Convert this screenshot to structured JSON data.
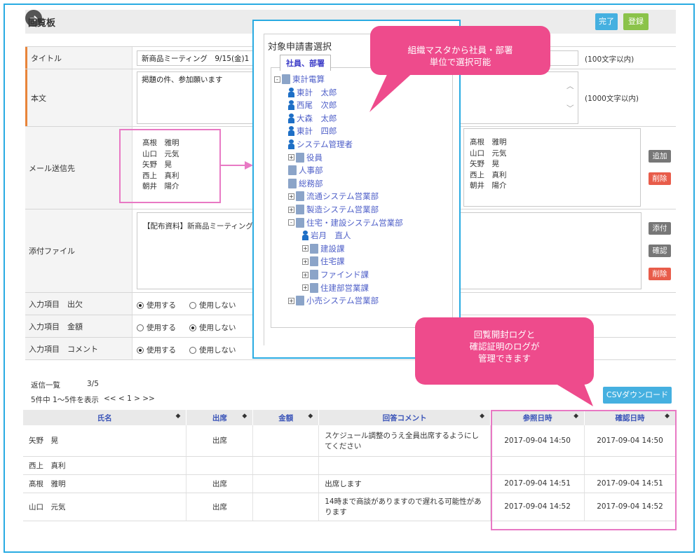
{
  "header": {
    "title": "回覧板",
    "done_label": "完了",
    "register_label": "登録",
    "back_icon": "➜"
  },
  "form": {
    "title_label": "タイトル",
    "title_value": "新商品ミーティング　9/15(金)1",
    "title_note": "(100文字以内)",
    "body_label": "本文",
    "body_value": "掲題の件、参加願います",
    "body_note": "(1000文字以内)",
    "mail_label": "メール送信先",
    "mail_recipients": [
      "髙根　雅明",
      "山口　元気",
      "矢野　晃",
      "西上　真利",
      "朝井　陽介"
    ],
    "mail_right": [
      "髙根　雅明",
      "山口　元気",
      "矢野　晃",
      "西上　真利",
      "朝井　陽介"
    ],
    "add_label": "追加",
    "delete_label": "削除",
    "attach_label": "添付ファイル",
    "attach_value": "【配布資料】新商品ミーティング",
    "attach_btn": "添付",
    "confirm_btn": "確認",
    "attach_delete": "削除",
    "attendance_label": "入力項目　出欠",
    "amount_label": "入力項目　金額",
    "comment_label": "入力項目　コメント",
    "use_label": "使用する",
    "nouse_label": "使用しない"
  },
  "dialog": {
    "title": "対象申請書選択",
    "tab_label": "社員、部署",
    "tree": [
      {
        "t": "東計電算",
        "kind": "org",
        "exp": "-",
        "lvl": 0
      },
      {
        "t": "東計　太郎",
        "kind": "person",
        "lvl": 1
      },
      {
        "t": "西尾　次郎",
        "kind": "person",
        "lvl": 1
      },
      {
        "t": "大森　太郎",
        "kind": "person",
        "lvl": 1
      },
      {
        "t": "東計　四郎",
        "kind": "person",
        "lvl": 1
      },
      {
        "t": "システム管理者",
        "kind": "person",
        "lvl": 1
      },
      {
        "t": "役員",
        "kind": "org",
        "exp": "+",
        "lvl": 1
      },
      {
        "t": "人事部",
        "kind": "org",
        "lvl": 1
      },
      {
        "t": "総務部",
        "kind": "org",
        "lvl": 1
      },
      {
        "t": "流通システム営業部",
        "kind": "org",
        "exp": "+",
        "lvl": 1
      },
      {
        "t": "製造システム営業部",
        "kind": "org",
        "exp": "+",
        "lvl": 1
      },
      {
        "t": "住宅・建設システム営業部",
        "kind": "org",
        "exp": "-",
        "lvl": 1
      },
      {
        "t": "岩月　直人",
        "kind": "person",
        "lvl": 2
      },
      {
        "t": "建設課",
        "kind": "org",
        "exp": "+",
        "lvl": 2
      },
      {
        "t": "住宅課",
        "kind": "org",
        "exp": "+",
        "lvl": 2
      },
      {
        "t": "ファインド課",
        "kind": "org",
        "exp": "+",
        "lvl": 2
      },
      {
        "t": "住建部営業課",
        "kind": "org",
        "exp": "+",
        "lvl": 2
      },
      {
        "t": "小売システム営業部",
        "kind": "org",
        "exp": "+",
        "lvl": 1
      }
    ]
  },
  "callouts": {
    "top": [
      "組織マスタから社員・部署",
      "単位で選択可能"
    ],
    "bottom": [
      "回覧開封ログと",
      "確認証明のログが",
      "管理できます"
    ]
  },
  "replies": {
    "heading": "返信一覧",
    "count": "3/5",
    "paging": "5件中 1～5件を表示",
    "pager": "<< < 1 > >>",
    "csv_label": "CSVダウンロード",
    "columns": [
      "氏名",
      "出席",
      "金額",
      "回答コメント",
      "参照日時",
      "確認日時"
    ],
    "rows": [
      {
        "name": "矢野　晃",
        "att": "出席",
        "amt": "",
        "comment": "スケジュール調整のうえ全員出席するようにしてください",
        "ref": "2017-09-04 14:50",
        "conf": "2017-09-04 14:50"
      },
      {
        "name": "西上　真利",
        "att": "",
        "amt": "",
        "comment": "",
        "ref": "",
        "conf": ""
      },
      {
        "name": "髙根　雅明",
        "att": "出席",
        "amt": "",
        "comment": "出席します",
        "ref": "2017-09-04 14:51",
        "conf": "2017-09-04 14:51"
      },
      {
        "name": "山口　元気",
        "att": "出席",
        "amt": "",
        "comment": "14時まで商談がありますので遅れる可能性があります",
        "ref": "2017-09-04 14:52",
        "conf": "2017-09-04 14:52"
      }
    ]
  },
  "colors": {
    "accent": "#29abe2",
    "callout": "#ee4b8c",
    "pink_border": "#e879c4",
    "tree_text": "#4e5fc8"
  }
}
